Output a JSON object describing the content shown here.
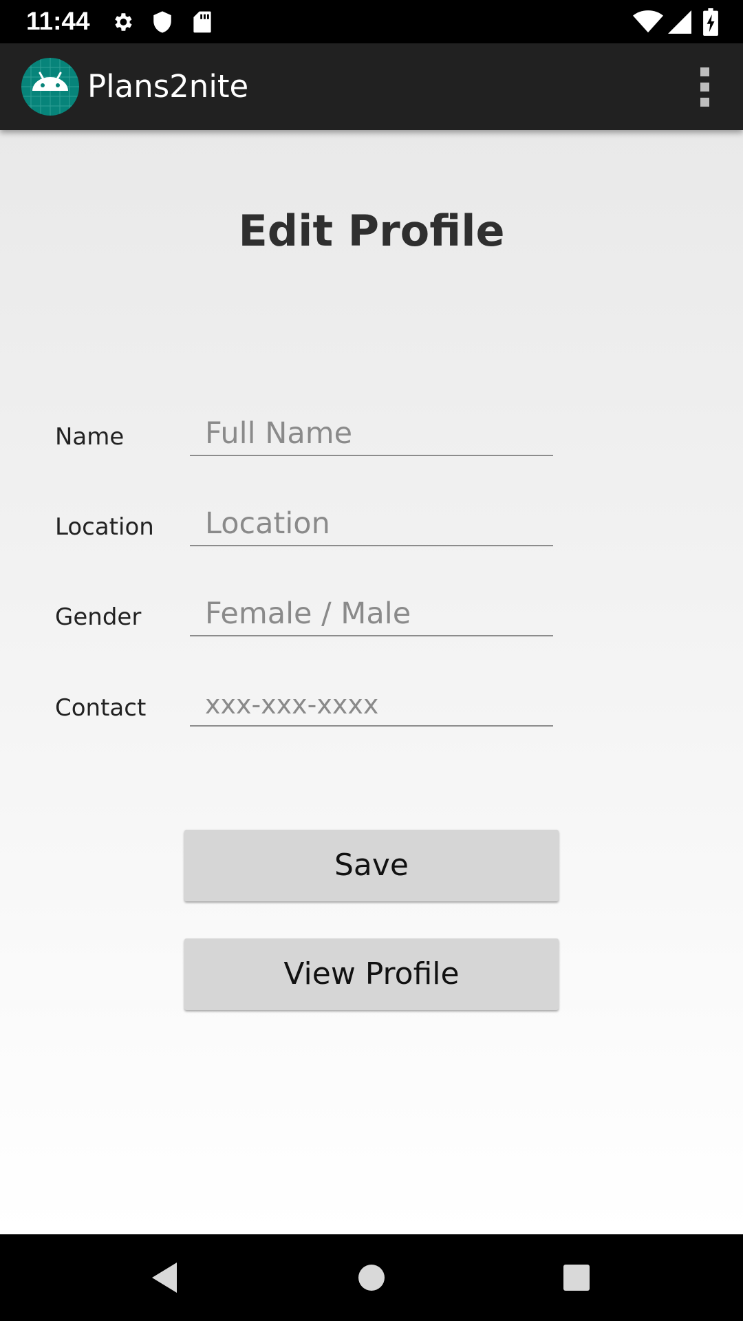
{
  "status_bar": {
    "time": "11:44",
    "icons": [
      "gear-icon",
      "shield-icon",
      "sd-card-icon",
      "wifi-icon",
      "signal-icon",
      "battery-charging-icon"
    ]
  },
  "app_bar": {
    "title": "Plans2nite",
    "logo_icon": "android-robot-icon",
    "menu_icon": "overflow-menu-icon"
  },
  "page": {
    "title": "Edit Profile"
  },
  "form": {
    "fields": [
      {
        "label": "Name",
        "placeholder": "Full Name",
        "value": ""
      },
      {
        "label": "Location",
        "placeholder": "Location",
        "value": ""
      },
      {
        "label": "Gender",
        "placeholder": "Female / Male",
        "value": ""
      },
      {
        "label": "Contact",
        "placeholder": "xxx-xxx-xxxx",
        "value": ""
      }
    ]
  },
  "buttons": {
    "save_label": "Save",
    "view_profile_label": "View Profile"
  },
  "nav_bar": {
    "icons": [
      "back-icon",
      "home-icon",
      "recents-icon"
    ]
  },
  "colors": {
    "status_bar": "#000000",
    "app_bar": "#212121",
    "logo_bg": "#07847a",
    "button_bg": "#d6d6d6",
    "title_text": "#2f2f2f"
  }
}
